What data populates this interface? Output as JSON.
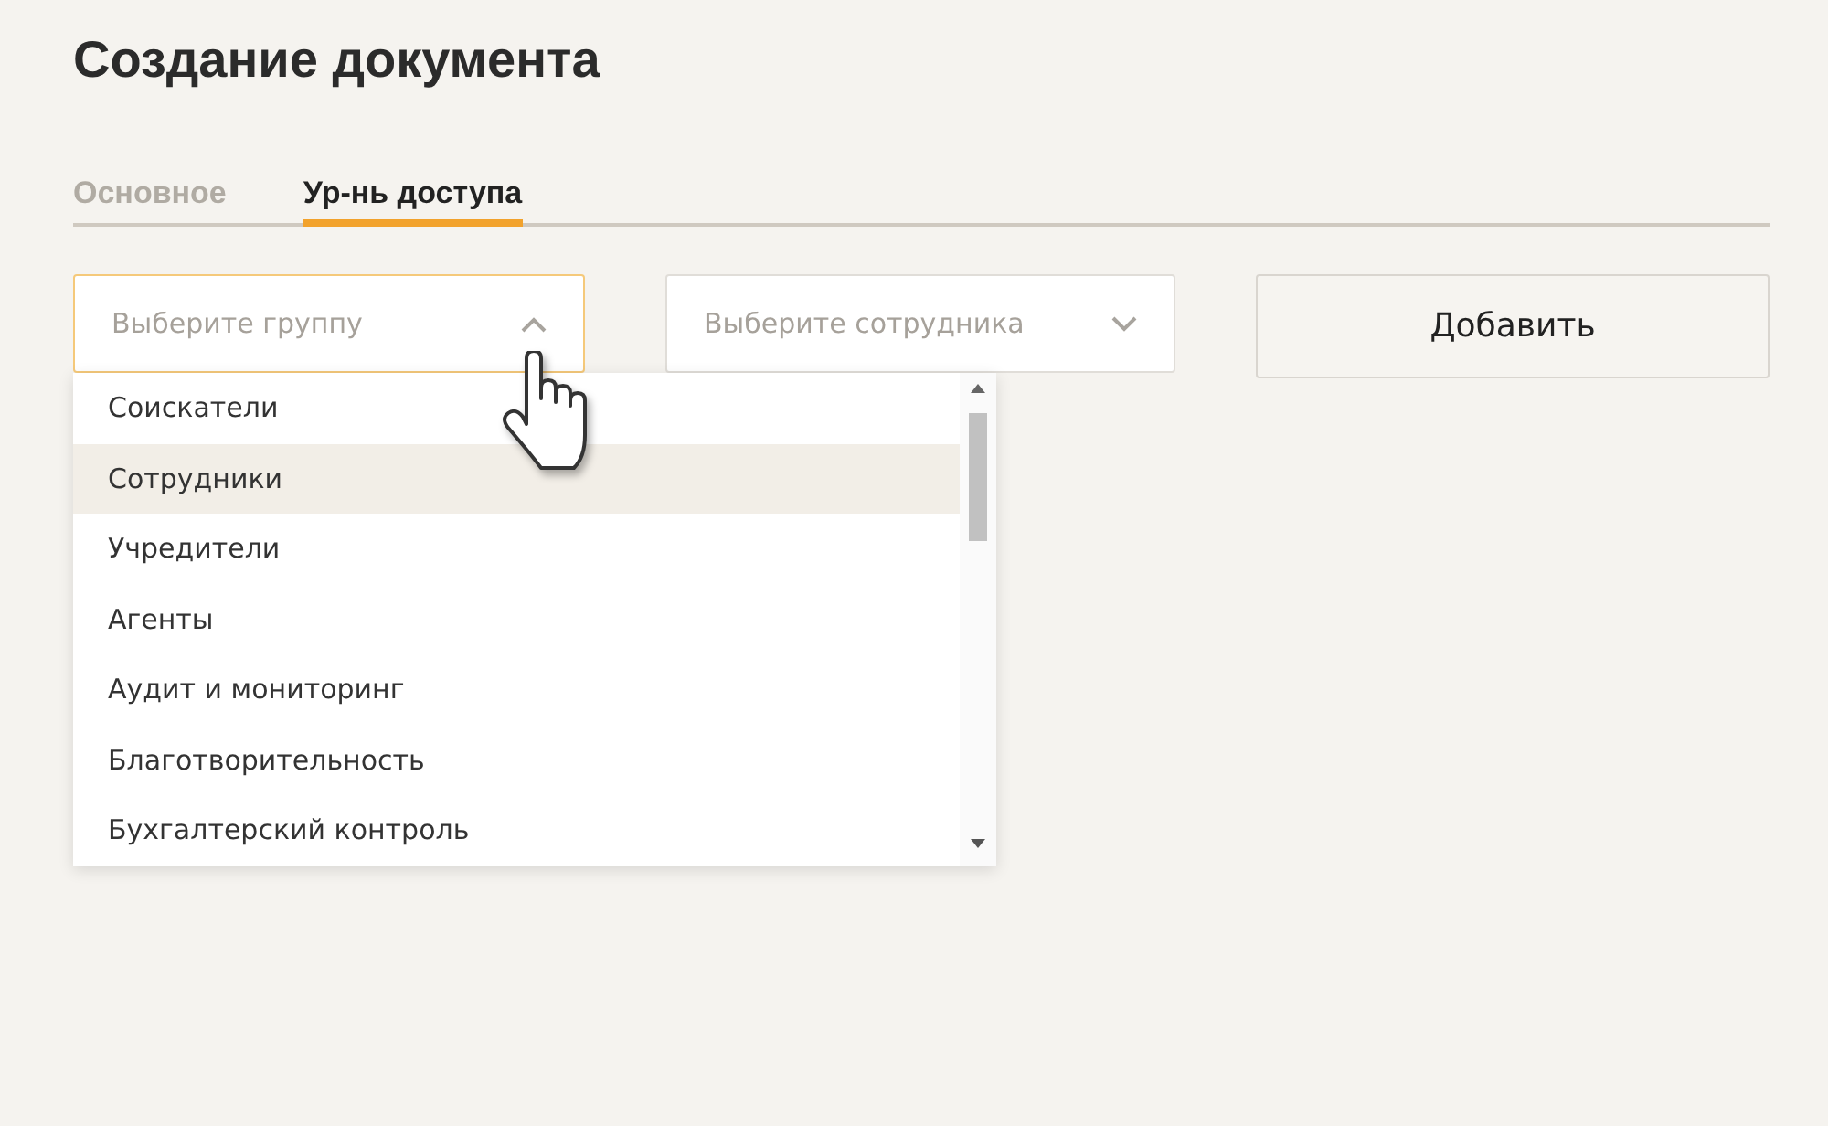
{
  "title": "Создание документа",
  "tabs": [
    {
      "label": "Основное",
      "selected": false
    },
    {
      "label": "Ур-нь доступа",
      "selected": true
    }
  ],
  "group_select": {
    "placeholder": "Выберите группу",
    "expanded": true,
    "options": [
      {
        "label": "Соискатели",
        "selected": false
      },
      {
        "label": "Сотрудники",
        "selected": true
      },
      {
        "label": "Учредители",
        "selected": false
      },
      {
        "label": "Агенты",
        "selected": false
      },
      {
        "label": "Аудит и мониторинг",
        "selected": false
      },
      {
        "label": "Благотворительность",
        "selected": false
      },
      {
        "label": "Бухгалтерский контроль",
        "selected": false
      }
    ]
  },
  "employee_select": {
    "placeholder": "Выберите сотрудника",
    "expanded": false
  },
  "add_button": {
    "label": "Добавить"
  }
}
